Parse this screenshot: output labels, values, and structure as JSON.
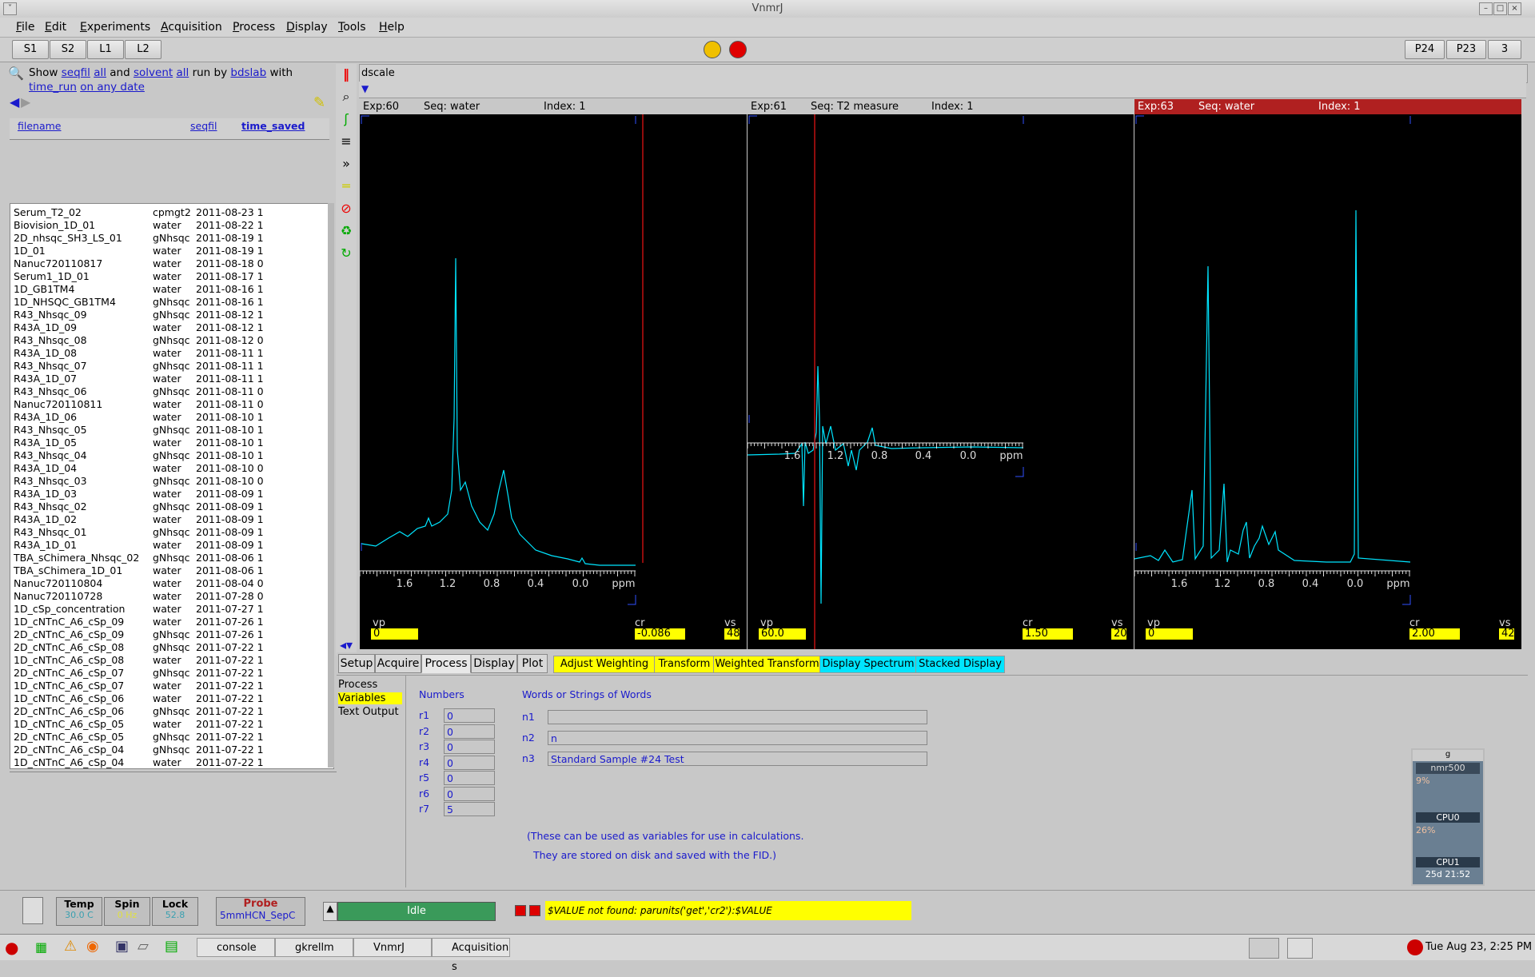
{
  "window": {
    "title": "VnmrJ"
  },
  "menu": [
    "File",
    "Edit",
    "Experiments",
    "Acquisition",
    "Process",
    "Display",
    "Tools",
    "Help"
  ],
  "toolbar": {
    "left_buttons": [
      "S1",
      "S2",
      "L1",
      "L2"
    ],
    "right_buttons": [
      "P24",
      "P23",
      "3"
    ]
  },
  "locator": {
    "show": "Show",
    "seqfil": "seqfil",
    "all1": "all",
    "and": "and",
    "solvent": "solvent",
    "all2": "all",
    "runby": "run by",
    "user": "bdslab",
    "with": "with",
    "time_run": "time_run",
    "anydate": "on any date",
    "columns": [
      "filename",
      "seqfil",
      "time_saved"
    ],
    "rows": [
      [
        "Serum_T2_02",
        "cpmgt2",
        "2011-08-23 1"
      ],
      [
        "Biovision_1D_01",
        "water",
        "2011-08-22 1"
      ],
      [
        "2D_nhsqc_SH3_LS_01",
        "gNhsqc",
        "2011-08-19 1"
      ],
      [
        "1D_01",
        "water",
        "2011-08-19 1"
      ],
      [
        "Nanuc720110817",
        "water",
        "2011-08-18 0"
      ],
      [
        "Serum1_1D_01",
        "water",
        "2011-08-17 1"
      ],
      [
        "1D_GB1TM4",
        "water",
        "2011-08-16 1"
      ],
      [
        "1D_NHSQC_GB1TM4",
        "gNhsqc",
        "2011-08-16 1"
      ],
      [
        "R43_Nhsqc_09",
        "gNhsqc",
        "2011-08-12 1"
      ],
      [
        "R43A_1D_09",
        "water",
        "2011-08-12 1"
      ],
      [
        "R43_Nhsqc_08",
        "gNhsqc",
        "2011-08-12 0"
      ],
      [
        "R43A_1D_08",
        "water",
        "2011-08-11 1"
      ],
      [
        "R43_Nhsqc_07",
        "gNhsqc",
        "2011-08-11 1"
      ],
      [
        "R43A_1D_07",
        "water",
        "2011-08-11 1"
      ],
      [
        "R43_Nhsqc_06",
        "gNhsqc",
        "2011-08-11 0"
      ],
      [
        "Nanuc720110811",
        "water",
        "2011-08-11 0"
      ],
      [
        "R43A_1D_06",
        "water",
        "2011-08-10 1"
      ],
      [
        "R43_Nhsqc_05",
        "gNhsqc",
        "2011-08-10 1"
      ],
      [
        "R43A_1D_05",
        "water",
        "2011-08-10 1"
      ],
      [
        "R43_Nhsqc_04",
        "gNhsqc",
        "2011-08-10 1"
      ],
      [
        "R43A_1D_04",
        "water",
        "2011-08-10 0"
      ],
      [
        "R43_Nhsqc_03",
        "gNhsqc",
        "2011-08-10 0"
      ],
      [
        "R43A_1D_03",
        "water",
        "2011-08-09 1"
      ],
      [
        "R43_Nhsqc_02",
        "gNhsqc",
        "2011-08-09 1"
      ],
      [
        "R43A_1D_02",
        "water",
        "2011-08-09 1"
      ],
      [
        "R43_Nhsqc_01",
        "gNhsqc",
        "2011-08-09 1"
      ],
      [
        "R43A_1D_01",
        "water",
        "2011-08-09 1"
      ],
      [
        "TBA_sChimera_Nhsqc_02",
        "gNhsqc",
        "2011-08-06 1"
      ],
      [
        "TBA_sChimera_1D_01",
        "water",
        "2011-08-06 1"
      ],
      [
        "Nanuc720110804",
        "water",
        "2011-08-04 0"
      ],
      [
        "Nanuc720110728",
        "water",
        "2011-07-28 0"
      ],
      [
        "1D_cSp_concentration",
        "water",
        "2011-07-27 1"
      ],
      [
        "1D_cNTnC_A6_cSp_09",
        "water",
        "2011-07-26 1"
      ],
      [
        "2D_cNTnC_A6_cSp_09",
        "gNhsqc",
        "2011-07-26 1"
      ],
      [
        "2D_cNTnC_A6_cSp_08",
        "gNhsqc",
        "2011-07-22 1"
      ],
      [
        "1D_cNTnC_A6_cSp_08",
        "water",
        "2011-07-22 1"
      ],
      [
        "2D_cNTnC_A6_cSp_07",
        "gNhsqc",
        "2011-07-22 1"
      ],
      [
        "1D_cNTnC_A6_cSp_07",
        "water",
        "2011-07-22 1"
      ],
      [
        "1D_cNTnC_A6_cSp_06",
        "water",
        "2011-07-22 1"
      ],
      [
        "2D_cNTnC_A6_cSp_06",
        "gNhsqc",
        "2011-07-22 1"
      ],
      [
        "1D_cNTnC_A6_cSp_05",
        "water",
        "2011-07-22 1"
      ],
      [
        "2D_cNTnC_A6_cSp_05",
        "gNhsqc",
        "2011-07-22 1"
      ],
      [
        "2D_cNTnC_A6_cSp_04",
        "gNhsqc",
        "2011-07-22 1"
      ],
      [
        "1D_cNTnC_A6_cSp_04",
        "water",
        "2011-07-22 1"
      ]
    ]
  },
  "command": {
    "text": "dscale"
  },
  "viewports": [
    {
      "exp": "Exp:60",
      "seq": "Seq: water",
      "index": "Index: 1",
      "vp_label": "vp",
      "vp": "0",
      "cr_label": "cr",
      "cr": "-0.086",
      "vs_label": "vs",
      "vs": "48",
      "ticks": [
        "1.6",
        "1.2",
        "0.8",
        "0.4",
        "0.0",
        "ppm"
      ]
    },
    {
      "exp": "Exp:61",
      "seq": "Seq: T2 measure",
      "index": "Index: 1",
      "vp_label": "vp",
      "vp": "60.0",
      "cr_label": "cr",
      "cr": "1.50",
      "vs_label": "vs",
      "vs": "20",
      "ticks": [
        "1.6",
        "1.2",
        "0.8",
        "0.4",
        "0.0",
        "ppm"
      ]
    },
    {
      "exp": "Exp:63",
      "seq": "Seq: water",
      "index": "Index: 1",
      "vp_label": "vp",
      "vp": "0",
      "cr_label": "cr",
      "cr": "2.00",
      "vs_label": "vs",
      "vs": "42",
      "ticks": [
        "1.6",
        "1.2",
        "0.8",
        "0.4",
        "0.0",
        "ppm"
      ]
    }
  ],
  "tabs": [
    "Setup",
    "Acquire",
    "Process",
    "Display",
    "Plot"
  ],
  "actions": [
    "Adjust Weighting",
    "Transform",
    "Weighted Transform",
    "Display Spectrum",
    "Stacked Display"
  ],
  "panel": {
    "side": [
      "Process",
      "Variables",
      "Text Output"
    ],
    "numbers_title": "Numbers",
    "words_title": "Words or Strings of Words",
    "numbers": [
      [
        "r1",
        "0"
      ],
      [
        "r2",
        "0"
      ],
      [
        "r3",
        "0"
      ],
      [
        "r4",
        "0"
      ],
      [
        "r5",
        "0"
      ],
      [
        "r6",
        "0"
      ],
      [
        "r7",
        "5"
      ]
    ],
    "strings": [
      [
        "n1",
        ""
      ],
      [
        "n2",
        "n"
      ],
      [
        "n3",
        "Standard Sample #24 Test"
      ]
    ],
    "note1": "(These can be used as variables for use in calculations.",
    "note2": "They are stored on disk and saved with the FID.)"
  },
  "status": {
    "temp_label": "Temp",
    "temp": "30.0 C",
    "spin_label": "Spin",
    "spin": "0 Hz",
    "lock_label": "Lock",
    "lock": "52.8",
    "probe_label": "Probe",
    "probe": "5mmHCN_SepC",
    "state": "Idle",
    "message": "$VALUE not found: parunits('get','cr2'):$VALUE"
  },
  "taskbar": {
    "tasks": [
      "console",
      "gkrellm",
      "VnmrJ",
      "Acquisition s"
    ],
    "clock": "Tue Aug 23,  2:25 PM"
  },
  "gkrellm": {
    "title": "g",
    "host": "nmr500",
    "cpu0_pct": "9%",
    "cpu0": "CPU0",
    "cpu1_pct": "26%",
    "cpu1": "CPU1",
    "uptime": "25d 21:52"
  },
  "colors": {
    "spectrum": "#00e5ff",
    "cursor": "#c01010",
    "highlight": "#ffff00",
    "active_header": "#b02020"
  }
}
